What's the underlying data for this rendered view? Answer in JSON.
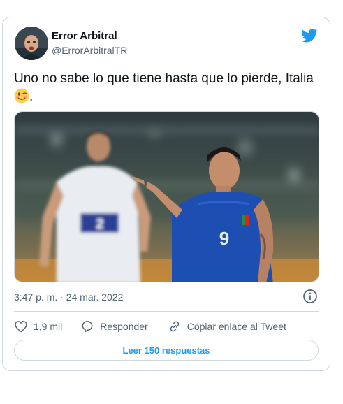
{
  "tweet": {
    "author_name": "Error Arbitral",
    "author_handle": "@ErrorArbitralTR",
    "text": "Uno no sabe lo que tiene hasta que lo pierde, Italia",
    "text_suffix": ".",
    "timestamp": "3:47 p. m. · 24 mar. 2022",
    "likes": "1,9 mil",
    "reply_label": "Responder",
    "copy_link_label": "Copiar enlace al Tweet",
    "read_replies_label": "Leer 150 respuestas"
  },
  "icons": {
    "brand": "twitter-bird-icon",
    "emoji": "winking-face-emoji",
    "info": "info-icon",
    "like": "heart-icon",
    "reply": "speech-bubble-icon",
    "copy_link": "link-icon"
  },
  "colors": {
    "brand_blue": "#1d9bf0",
    "text_primary": "#0f1419",
    "text_secondary": "#536471",
    "border": "#cfd9de"
  }
}
